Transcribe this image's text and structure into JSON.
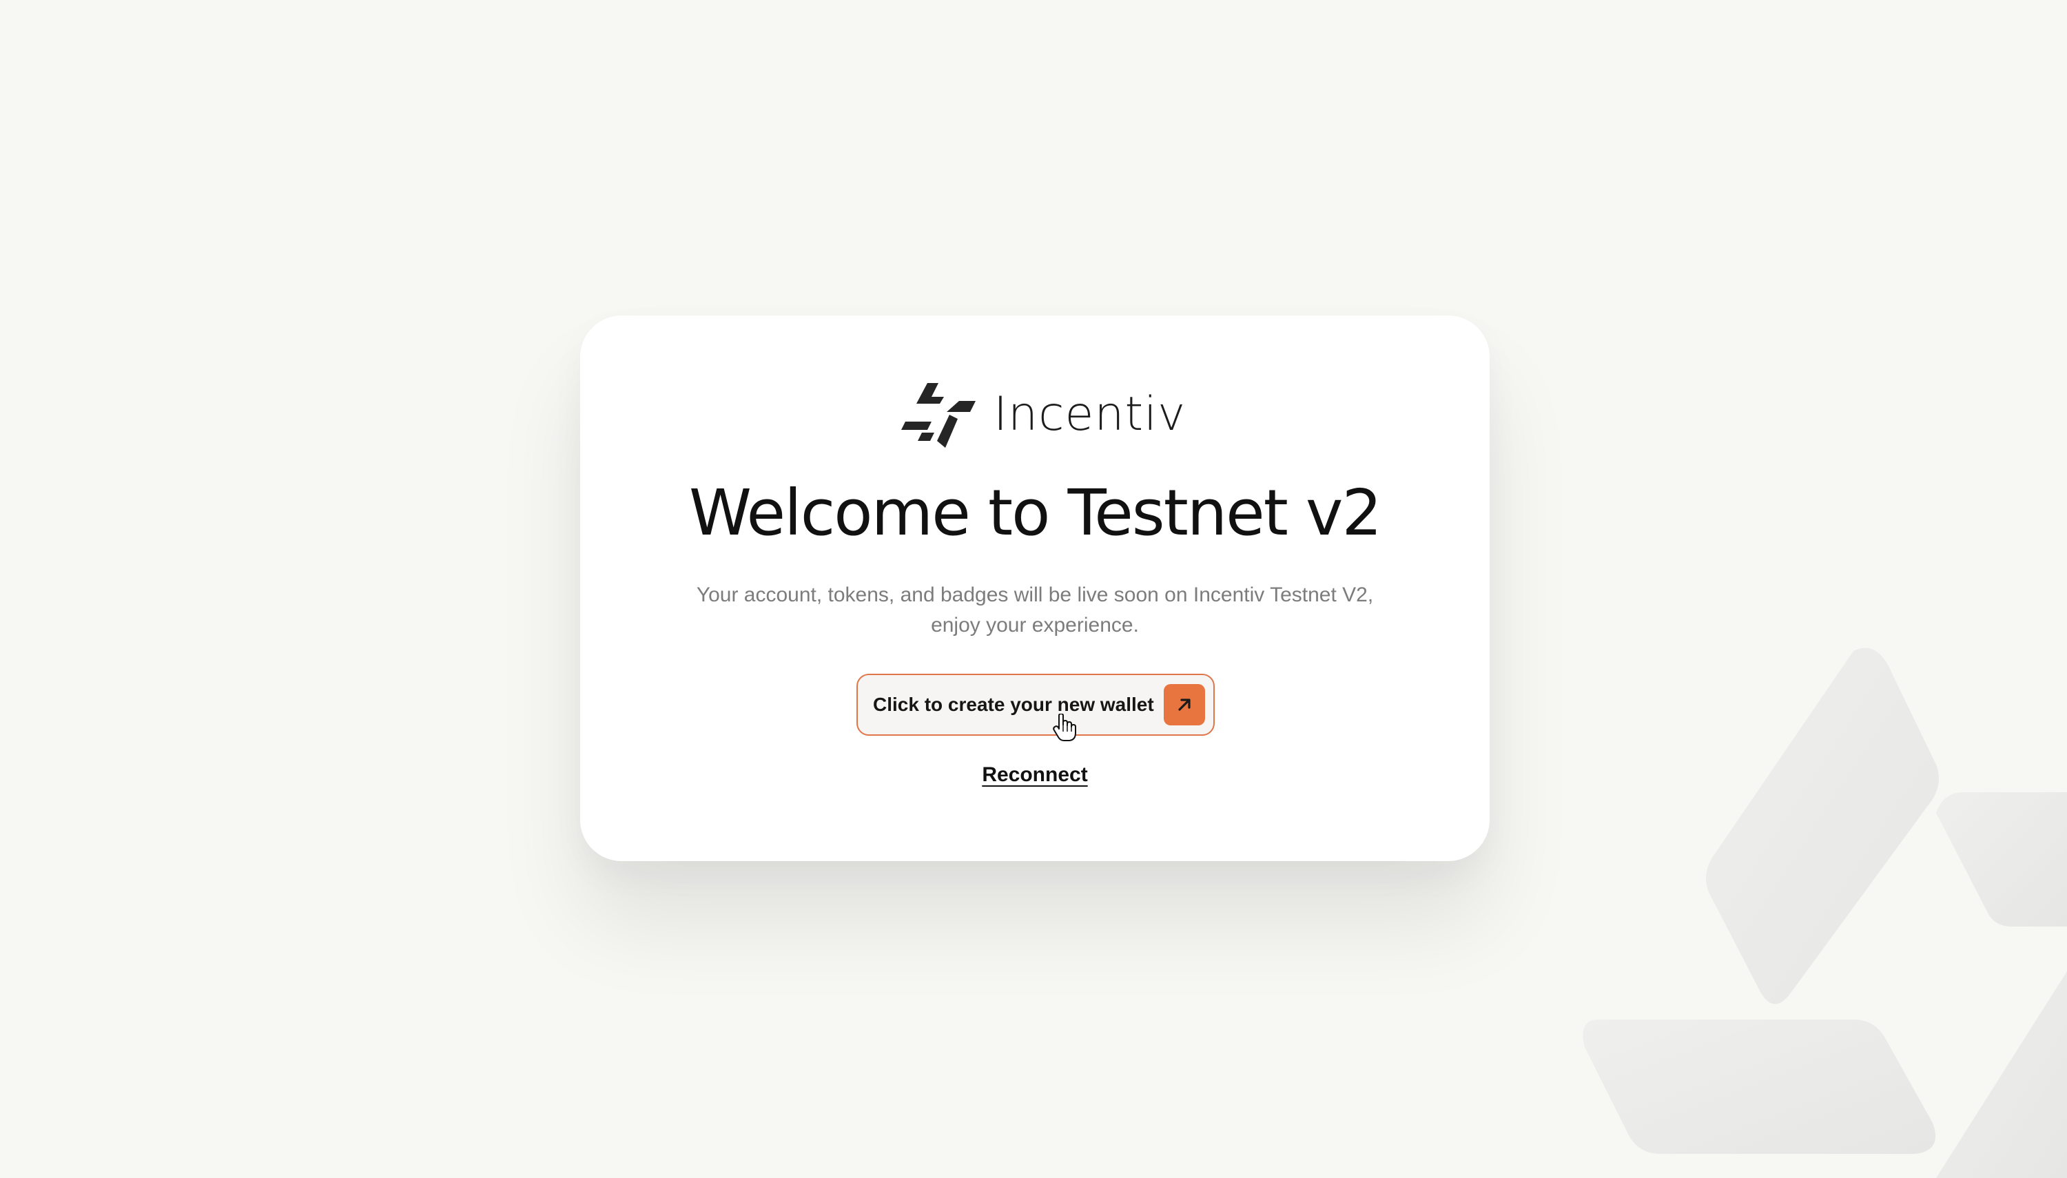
{
  "brand": {
    "name": "Incentiv",
    "logo_icon": "incentiv-logo-icon"
  },
  "welcome": {
    "title": "Welcome to Testnet v2",
    "subtitle_line1": "Your account, tokens, and badges will be live soon on Incentiv Testnet V2,",
    "subtitle_line2": "enjoy your experience."
  },
  "actions": {
    "create_wallet_label": "Click to create your new wallet",
    "create_wallet_icon": "arrow-up-right-icon",
    "reconnect_label": "Reconnect"
  },
  "colors": {
    "background": "#f7f7f4",
    "card": "#ffffff",
    "accent": "#e8743f",
    "button_border": "#e0754a",
    "text_primary": "#111111",
    "text_secondary": "#7c7c7c"
  }
}
